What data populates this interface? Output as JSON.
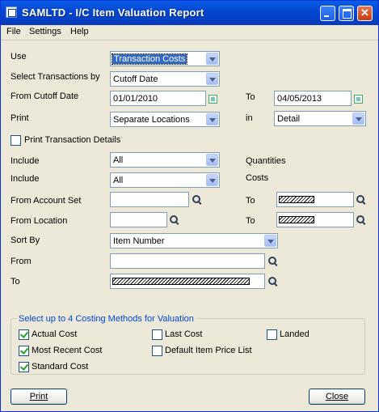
{
  "window": {
    "title": "SAMLTD - I/C Item Valuation Report"
  },
  "menu": {
    "file": "File",
    "settings": "Settings",
    "help": "Help"
  },
  "form": {
    "use_label": "Use",
    "use_value": "Transaction Costs",
    "select_by_label": "Select Transactions by",
    "select_by_value": "Cutoff Date",
    "from_cutoff_label": "From Cutoff Date",
    "from_cutoff_value": "01/01/2010",
    "to_label": "To",
    "to_cutoff_value": "04/05/2013",
    "print_label": "Print",
    "print_value": "Separate Locations",
    "in_label": "in",
    "in_value": "Detail",
    "print_details_label": "Print Transaction Details",
    "print_details_checked": false,
    "include_label": "Include",
    "include_qty_value": "All",
    "include_qty_suffix": "Quantities",
    "include_cost_value": "All",
    "include_cost_suffix": "Costs",
    "from_account_label": "From Account Set",
    "from_account_value": "",
    "from_location_label": "From Location",
    "from_location_value": "",
    "sort_by_label": "Sort By",
    "sort_by_value": "Item Number",
    "from_label": "From",
    "from_value": ""
  },
  "costing": {
    "title": "Select up to 4 Costing Methods for Valuation",
    "actual_cost": "Actual Cost",
    "most_recent_cost": "Most Recent Cost",
    "standard_cost": "Standard Cost",
    "last_cost": "Last Cost",
    "default_price_list": "Default Item Price List",
    "landed": "Landed",
    "checked": {
      "actual_cost": true,
      "most_recent_cost": true,
      "standard_cost": true,
      "last_cost": false,
      "default_price_list": false,
      "landed": false
    }
  },
  "buttons": {
    "print": "Print",
    "close": "Close"
  },
  "colors": {
    "titlebar": "#0a5ee8",
    "group_title": "#0046d5",
    "check": "#21a121"
  }
}
